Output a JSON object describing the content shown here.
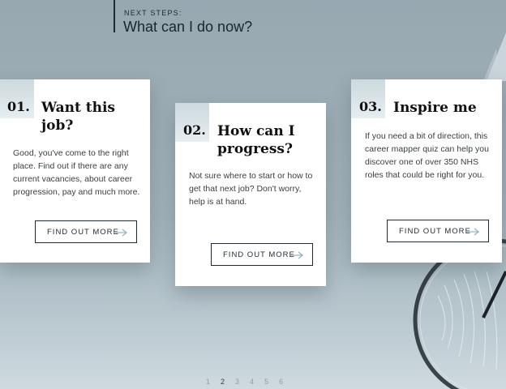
{
  "header": {
    "eyebrow": "NEXT STEPS:",
    "title": "What can I do now?"
  },
  "cards": [
    {
      "number": "01.",
      "title_line1": "Want this",
      "title_line2": "job?",
      "description_lines": [
        "Good, you've come to the right",
        "place. Find out if there are any",
        "current vacancies, about career",
        "progression, pay and much more."
      ],
      "button_label": "FIND OUT MORE"
    },
    {
      "number": "02.",
      "title_line1": "How can I",
      "title_line2": "progress?",
      "description_lines": [
        "Not sure where to start or how to",
        "get that next job? Don't worry,",
        "help is at hand."
      ],
      "button_label": "FIND OUT MORE"
    },
    {
      "number": "03.",
      "title_line1": "Inspire me",
      "title_line2": "",
      "description_lines": [
        "If you need a bit of direction, this",
        "career mapper quiz can help you",
        "discover one of over 350 NHS",
        "roles that could be right for you."
      ],
      "button_label": "FIND OUT MORE"
    }
  ],
  "pagination": {
    "pages": [
      "1",
      "2",
      "3",
      "4",
      "5",
      "6"
    ],
    "current": "2"
  },
  "colors": {
    "accent_arrow": "#8fb3c3",
    "ink": "#1f2a30"
  }
}
